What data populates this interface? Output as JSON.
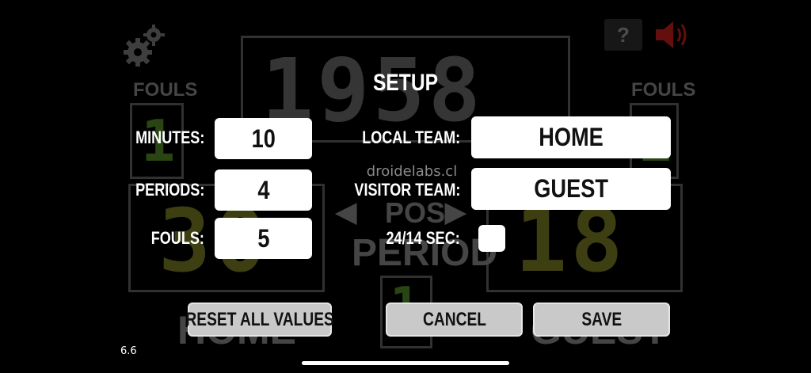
{
  "app": {
    "watermark": "droidelabs.cl",
    "version": "6.6"
  },
  "scoreboard": {
    "clock": "1958",
    "home_fouls_label": "FOULS",
    "guest_fouls_label": "FOULS",
    "home_fouls": "1",
    "guest_fouls": "1",
    "home_score": "30",
    "guest_score": "18",
    "period_label": "PERIOD",
    "possession_label": "POS",
    "period_value": "1",
    "home_name": "HOME",
    "guest_name": "GUEST"
  },
  "setup": {
    "title": "SETUP",
    "minutes_label": "MINUTES:",
    "minutes_value": "10",
    "periods_label": "PERIODS:",
    "periods_value": "4",
    "fouls_label": "FOULS:",
    "fouls_value": "5",
    "local_team_label": "LOCAL TEAM:",
    "local_team_value": "HOME",
    "visitor_team_label": "VISITOR TEAM:",
    "visitor_team_value": "GUEST",
    "shot_clock_label": "24/14 SEC:",
    "shot_clock_checked": false
  },
  "buttons": {
    "reset_label": "RESET ALL VALUES",
    "cancel_label": "CANCEL",
    "save_label": "SAVE"
  },
  "icons": {
    "settings": "gear-icon",
    "help": "question-icon",
    "sound": "speaker-icon"
  },
  "colors": {
    "background": "#000000",
    "sound_icon": "#d11a1a",
    "field_bg": "#ffffff",
    "button_bg": "#c9c9c9"
  }
}
